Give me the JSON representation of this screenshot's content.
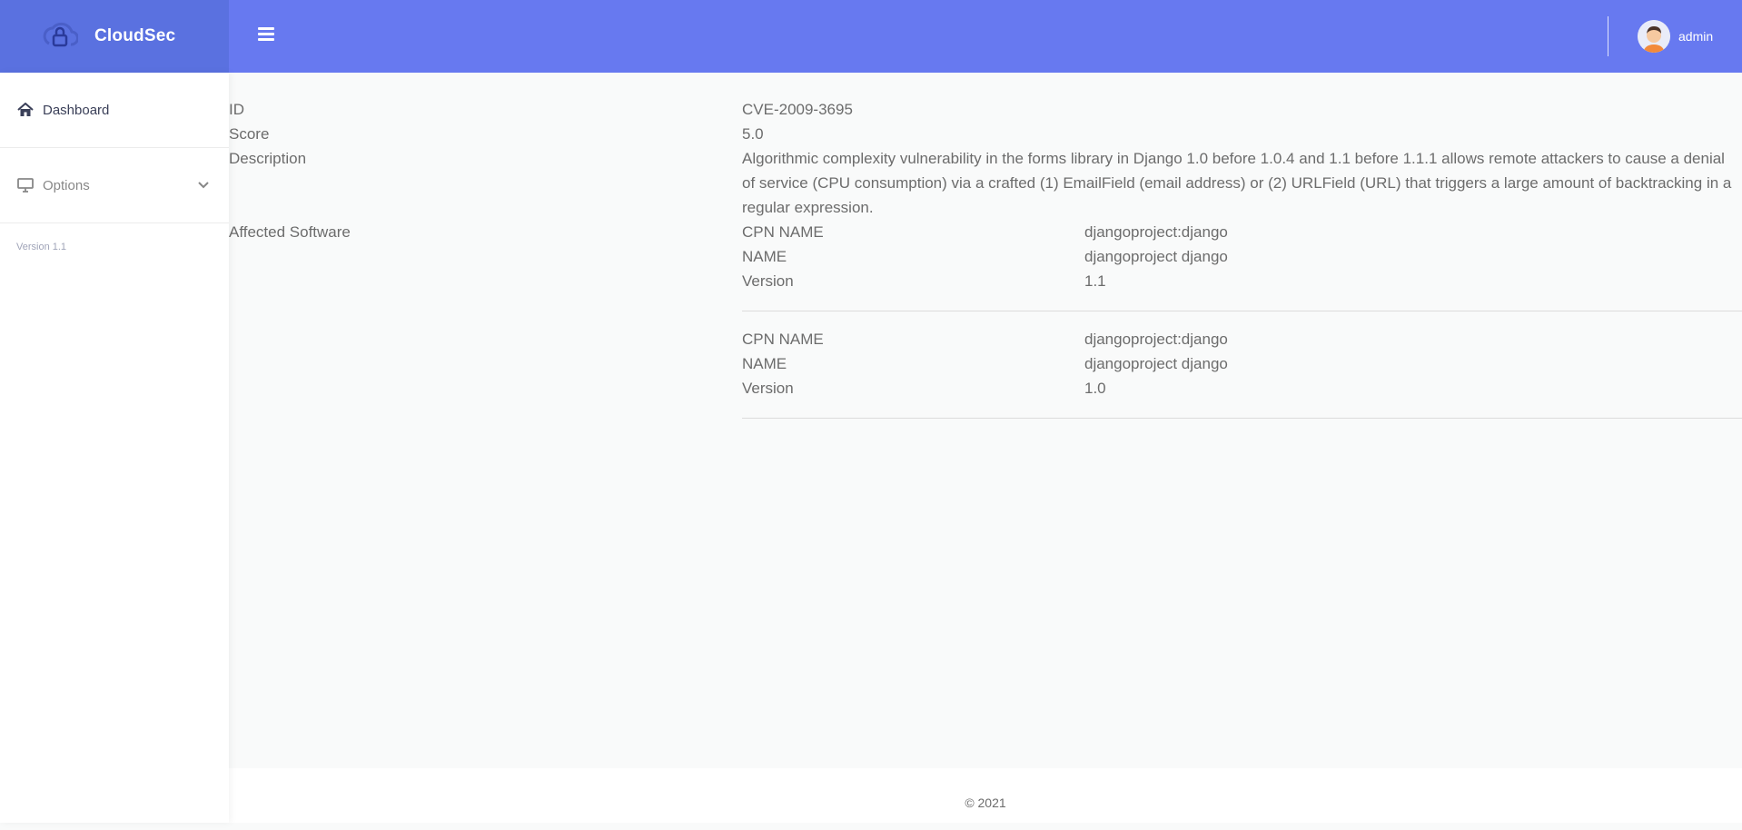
{
  "brand": {
    "name": "CloudSec"
  },
  "user": {
    "name": "admin"
  },
  "sidebar": {
    "items": [
      {
        "label": "Dashboard",
        "icon": "home-icon"
      },
      {
        "label": "Options",
        "icon": "monitor-icon"
      }
    ],
    "version": "Version 1.1"
  },
  "details": {
    "id_label": "ID",
    "id_value": "CVE-2009-3695",
    "score_label": "Score",
    "score_value": "5.0",
    "description_label": "Description",
    "description_value": "Algorithmic complexity vulnerability in the forms library in Django 1.0 before 1.0.4 and 1.1 before 1.1.1 allows remote attackers to cause a denial of service (CPU consumption) via a crafted (1) EmailField (email address) or (2) URLField (URL) that triggers a large amount of backtracking in a regular expression.",
    "affected_label": "Affected Software",
    "software": [
      {
        "cpn_label": "CPN NAME",
        "cpn": "djangoproject:django",
        "name_label": "NAME",
        "name": "djangoproject django",
        "version_label": "Version",
        "version": "1.1"
      },
      {
        "cpn_label": "CPN NAME",
        "cpn": "djangoproject:django",
        "name_label": "NAME",
        "name": "djangoproject django",
        "version_label": "Version",
        "version": "1.0"
      }
    ]
  },
  "footer": {
    "copyright": "© 2021"
  },
  "colors": {
    "brand_bg": "#5a71e0",
    "topbar_bg": "#6779f0",
    "page_bg": "#f9fafa"
  }
}
